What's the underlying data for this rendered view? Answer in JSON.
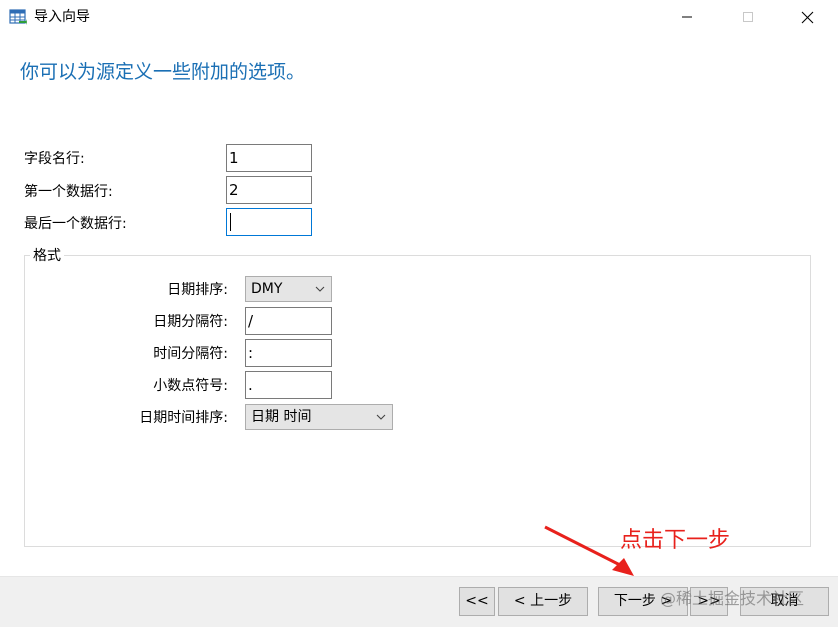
{
  "window": {
    "title": "导入向导",
    "minimize_icon": "minimize-icon",
    "maximize_icon": "maximize-icon",
    "close_icon": "close-icon"
  },
  "heading": "你可以为源定义一些附加的选项。",
  "rows": {
    "field_name_row": {
      "label": "字段名行:",
      "value": "1"
    },
    "first_data_row": {
      "label": "第一个数据行:",
      "value": "2"
    },
    "last_data_row": {
      "label": "最后一个数据行:",
      "value": ""
    }
  },
  "format": {
    "title": "格式",
    "date_order": {
      "label": "日期排序:",
      "value": "DMY"
    },
    "date_separator": {
      "label": "日期分隔符:",
      "value": "/"
    },
    "time_separator": {
      "label": "时间分隔符:",
      "value": ":"
    },
    "decimal_symbol": {
      "label": "小数点符号:",
      "value": "."
    },
    "datetime_order": {
      "label": "日期时间排序:",
      "value": "日期 时间"
    }
  },
  "footer": {
    "first_label": "<<",
    "back_label": "< 上一步",
    "next_label": "下一步 >",
    "last_label": ">>",
    "cancel_label": "取消"
  },
  "annotation": {
    "text": "点击下一步",
    "color": "#e8211c"
  },
  "watermark": "@稀土掘金技术社区",
  "colors": {
    "heading": "#1a6fb4",
    "focus_border": "#0078d7",
    "footer_bg": "#f0f0f0"
  }
}
